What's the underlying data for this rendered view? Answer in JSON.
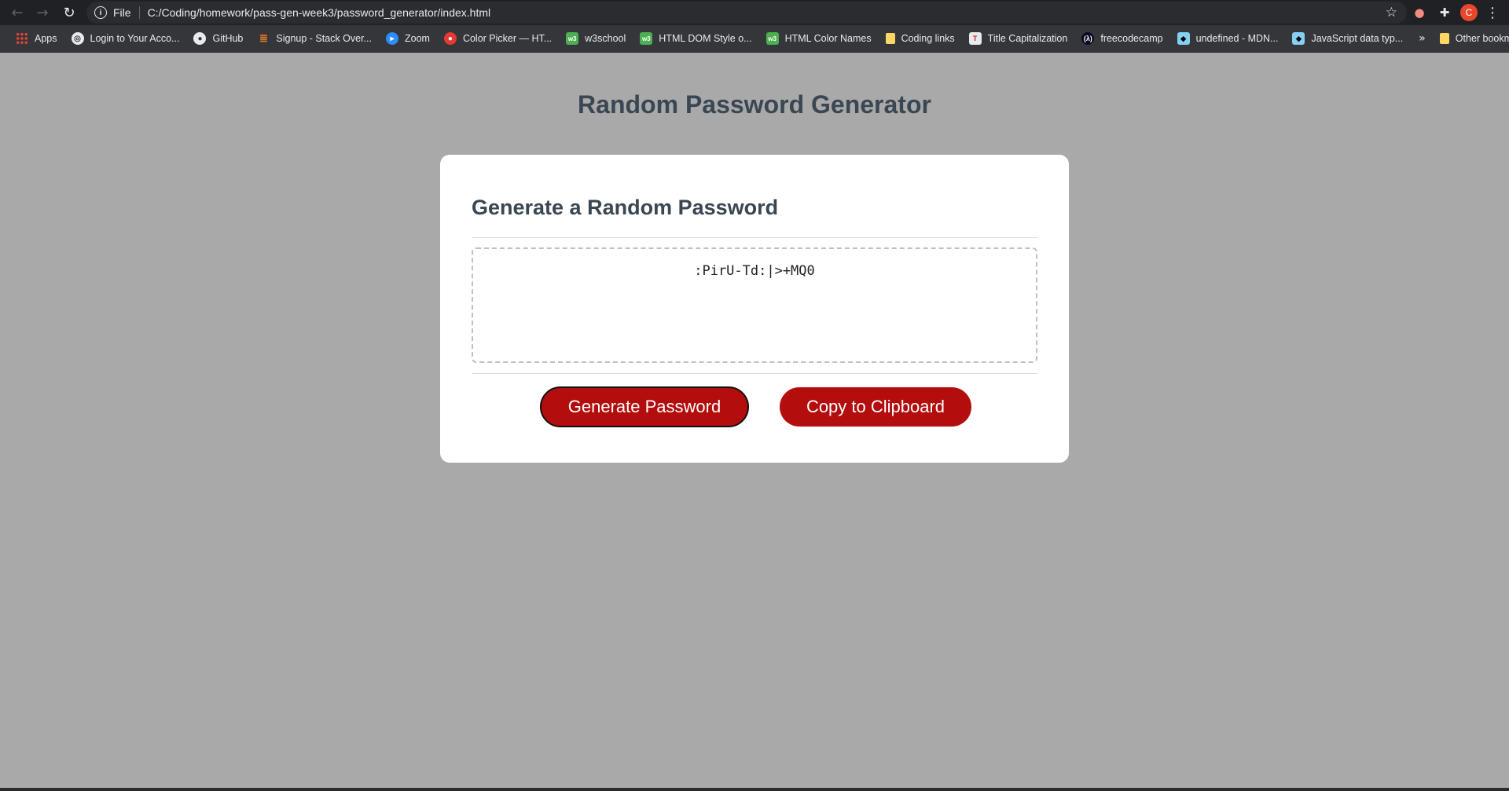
{
  "browser": {
    "scheme": "File",
    "url": "C:/Coding/homework/pass-gen-week3/password_generator/index.html",
    "avatar_letter": "C",
    "bookmarks": [
      {
        "label": "Apps"
      },
      {
        "label": "Login to Your Acco..."
      },
      {
        "label": "GitHub"
      },
      {
        "label": "Signup - Stack Over..."
      },
      {
        "label": "Zoom"
      },
      {
        "label": "Color Picker — HT..."
      },
      {
        "label": "w3school"
      },
      {
        "label": "HTML DOM Style o..."
      },
      {
        "label": "HTML Color Names"
      },
      {
        "label": "Coding links"
      },
      {
        "label": "Title Capitalization"
      },
      {
        "label": "freecodecamp"
      },
      {
        "label": "undefined - MDN..."
      },
      {
        "label": "JavaScript data typ..."
      }
    ],
    "more_label": "»",
    "other_bookmarks": "Other bookmarks"
  },
  "page": {
    "title": "Random Password Generator",
    "card_title": "Generate a Random Password",
    "password": ":PirU-Td:|>+MQ0",
    "generate_label": "Generate Password",
    "copy_label": "Copy to Clipboard"
  },
  "colors": {
    "background": "#a9a9a9",
    "heading": "#3a4652",
    "button": "#b30d0d"
  }
}
